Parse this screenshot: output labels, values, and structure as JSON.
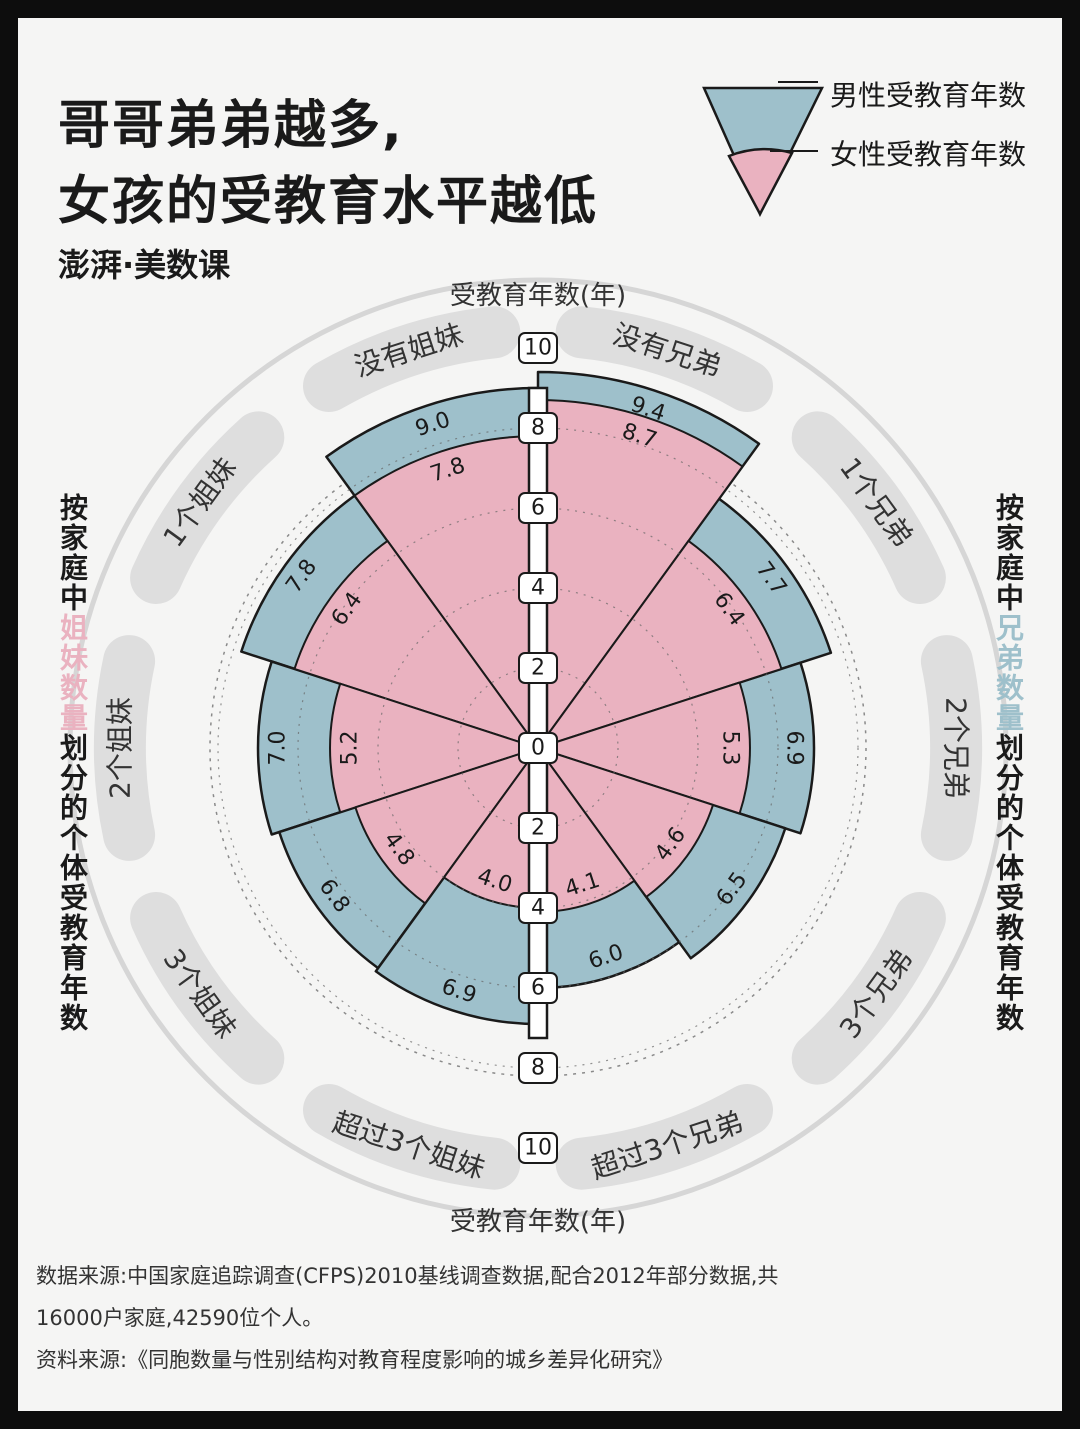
{
  "title": {
    "line1": "哥哥弟弟越多,",
    "line2": "女孩的受教育水平越低"
  },
  "brand": "澎湃·美数课",
  "legend": {
    "male": "男性受教育年数",
    "female": "女性受教育年数",
    "male_color": "#9ec0cb",
    "female_color": "#eab2c0"
  },
  "side_labels": {
    "left": [
      "按家庭中",
      "姐妹数量",
      "划分的个体受教育年数"
    ],
    "right": [
      "按家庭中",
      "兄弟数量",
      "划分的个体受教育年数"
    ]
  },
  "chart_data": {
    "type": "polar-bar",
    "axis_label": "受教育年数(年)",
    "axis_ticks": [
      0,
      2,
      4,
      6,
      8,
      10
    ],
    "rmax": 10,
    "series": [
      {
        "name": "男性受教育年数",
        "color": "#9ec0cb"
      },
      {
        "name": "女性受教育年数",
        "color": "#eab2c0"
      }
    ],
    "groups": [
      {
        "title": "按家庭中兄弟数量划分的个体受教育年数",
        "categories": [
          "没有兄弟",
          "1个兄弟",
          "2个兄弟",
          "3个兄弟",
          "超过3个兄弟"
        ],
        "male": [
          9.4,
          7.7,
          6.9,
          6.5,
          6.0
        ],
        "female": [
          8.7,
          6.4,
          5.3,
          4.6,
          4.1
        ]
      },
      {
        "title": "按家庭中姐妹数量划分的个体受教育年数",
        "categories": [
          "没有姐妹",
          "1个姐妹",
          "2个姐妹",
          "3个姐妹",
          "超过3个姐妹"
        ],
        "male": [
          9.0,
          7.8,
          7.0,
          6.8,
          6.9
        ],
        "female": [
          7.8,
          6.4,
          5.2,
          4.8,
          4.0
        ]
      }
    ]
  },
  "notes": {
    "source_line1": "数据来源:中国家庭追踪调查(CFPS)2010基线调查数据,配合2012年部分数据,共",
    "source_line2": "16000户家庭,42590位个人。",
    "reference": "资料来源:《同胞数量与性别结构对教育程度影响的城乡差异化研究》"
  }
}
